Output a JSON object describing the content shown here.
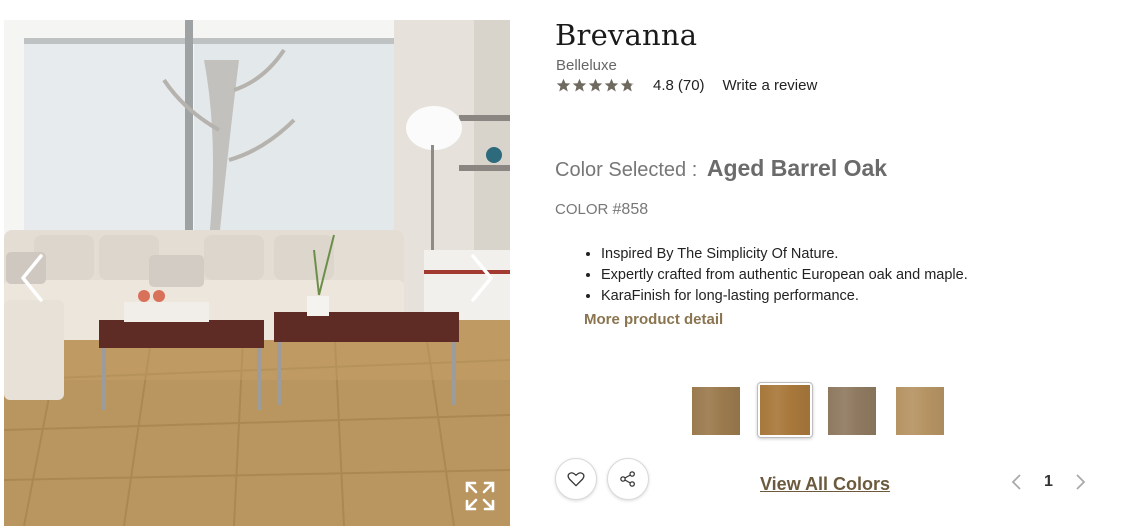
{
  "product": {
    "title": "Brevanna",
    "brand": "Belleluxe",
    "rating": {
      "value": "4.8",
      "count": "(70)",
      "stars": 4.8,
      "write_review": "Write a review"
    },
    "color_selected_label": "Color Selected :",
    "color_selected_name": "Aged Barrel Oak",
    "color_number_label": "COLOR",
    "color_number": "#858",
    "features": [
      "Inspired By The Simplicity Of Nature.",
      "Expertly crafted from authentic European oak and maple.",
      "KaraFinish for long-lasting performance."
    ],
    "more_detail": "More product detail"
  },
  "swatches": [
    {
      "color": "#9b7a4e",
      "selected": false
    },
    {
      "color": "#a8783b",
      "selected": true
    },
    {
      "color": "#8f7a60",
      "selected": false
    },
    {
      "color": "#b69463",
      "selected": false
    }
  ],
  "actions": {
    "view_all_colors": "View All Colors"
  },
  "pager": {
    "current": "1"
  },
  "icons": {
    "prev": "chevron-left-icon",
    "next": "chevron-right-icon",
    "expand": "expand-icon",
    "favorite": "heart-icon",
    "share": "share-icon"
  },
  "colors": {
    "accent": "#8a7550",
    "link": "#6b5a3e",
    "star": "#6e6a60"
  }
}
